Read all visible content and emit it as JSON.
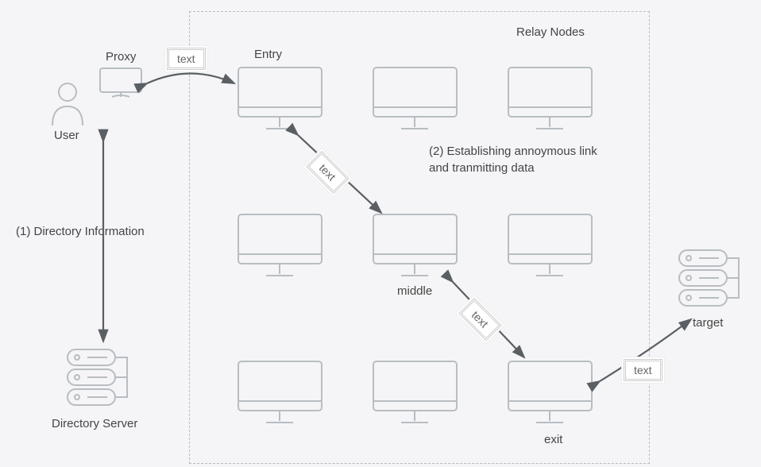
{
  "labels": {
    "relay_nodes": "Relay Nodes",
    "proxy": "Proxy",
    "entry": "Entry",
    "user": "User",
    "dir_info": "(1) Directory Information",
    "establishing": "(2) Establishing annoymous link\nand tranmitting data",
    "middle": "middle",
    "exit": "exit",
    "target": "target",
    "dir_server": "Directory Server",
    "text": "text"
  }
}
